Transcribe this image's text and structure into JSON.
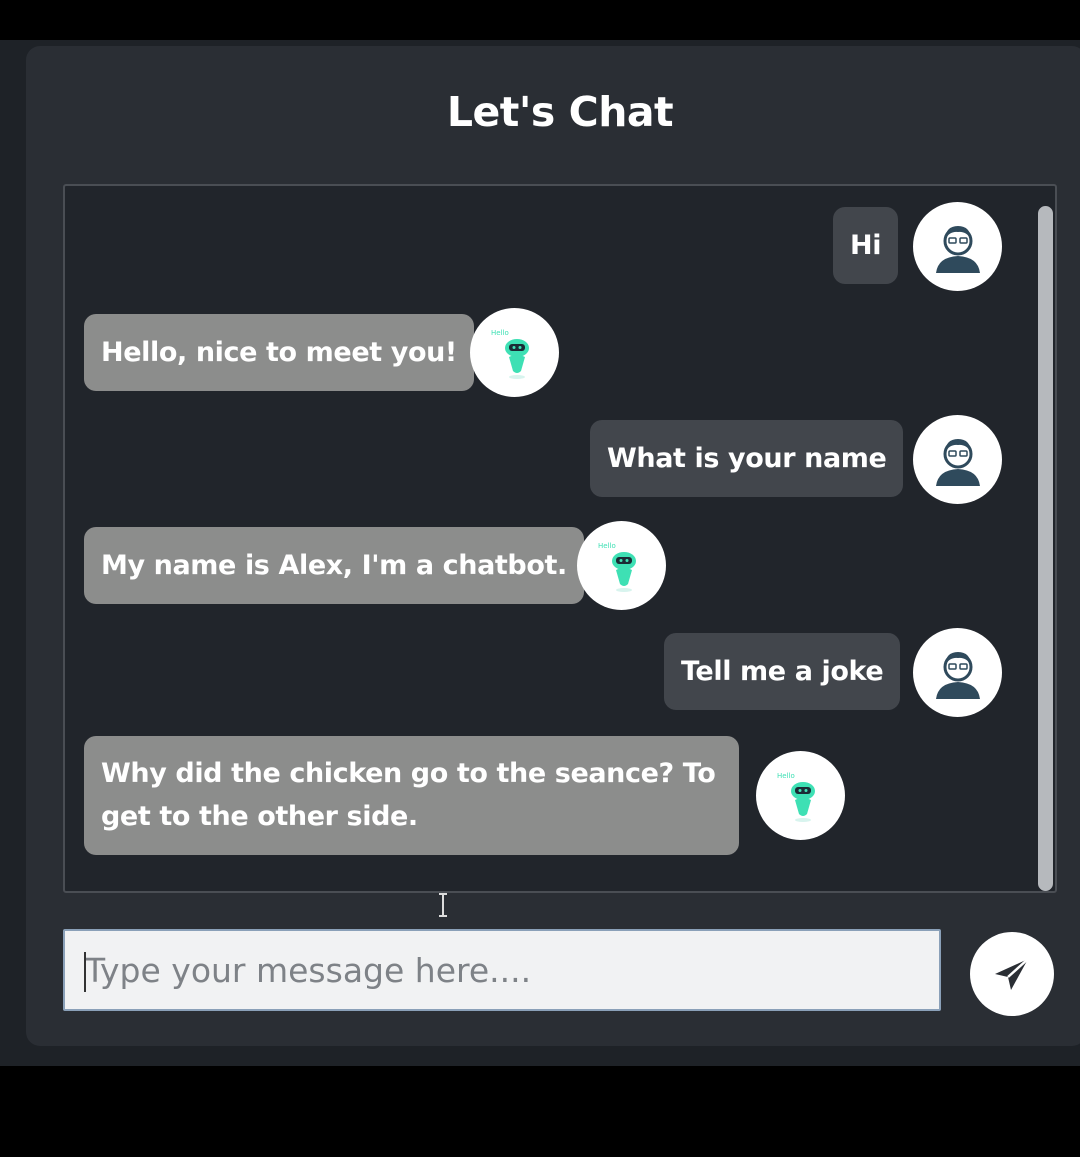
{
  "header": {
    "title": "Let's Chat"
  },
  "messages": [
    {
      "sender": "user",
      "text": "Hi"
    },
    {
      "sender": "bot",
      "text": "Hello, nice to meet you!"
    },
    {
      "sender": "user",
      "text": "What is your name"
    },
    {
      "sender": "bot",
      "text": "My name is Alex, I'm a chatbot."
    },
    {
      "sender": "user",
      "text": "Tell me a joke"
    },
    {
      "sender": "bot",
      "text": "Why did the chicken go to the seance? To get to the other side."
    }
  ],
  "composer": {
    "placeholder": "Type your message here....",
    "value": "",
    "send_icon": "send-icon"
  },
  "colors": {
    "user_bubble": "#42464c",
    "bot_bubble": "#8c8d8c",
    "bot_accent": "#3ee0b4",
    "user_avatar": "#2f4a5c"
  }
}
